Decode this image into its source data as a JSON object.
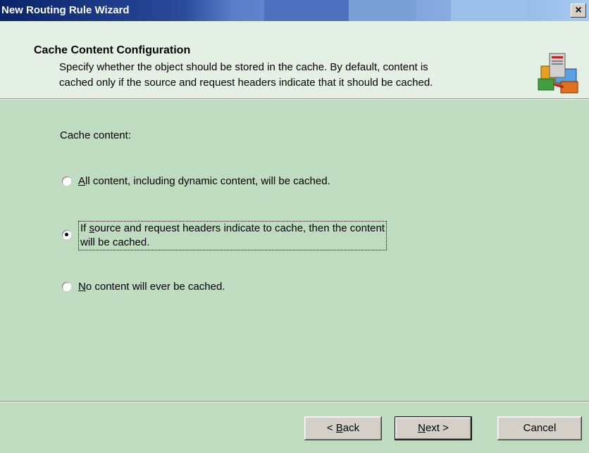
{
  "window": {
    "title": "New Routing Rule Wizard",
    "close_label": "×"
  },
  "header": {
    "title": "Cache Content Configuration",
    "description_line1": "Specify whether the object should be stored in the cache. By default, content is",
    "description_line2": "cached only if the source and request headers indicate that it should be cached.",
    "icon": "routing-rule-icon"
  },
  "content": {
    "label": "Cache content:",
    "options": [
      {
        "mnemonic": "A",
        "rest": "ll content, including dynamic content, will be cached.",
        "checked": false
      },
      {
        "prefix": "If ",
        "mnemonic": "s",
        "rest": "ource and request headers indicate to cache, then the content",
        "line2": "will be cached.",
        "checked": true
      },
      {
        "mnemonic": "N",
        "rest": "o content will ever be cached.",
        "checked": false
      }
    ]
  },
  "buttons": {
    "back": {
      "prefix": "< ",
      "mnemonic": "B",
      "rest": "ack"
    },
    "next": {
      "mnemonic": "N",
      "rest": "ext >"
    },
    "cancel": {
      "label": "Cancel"
    }
  },
  "colors": {
    "title_bar": "#0a246a",
    "header_bg": "#e5f0e5",
    "content_bg": "#c0dcc0"
  }
}
